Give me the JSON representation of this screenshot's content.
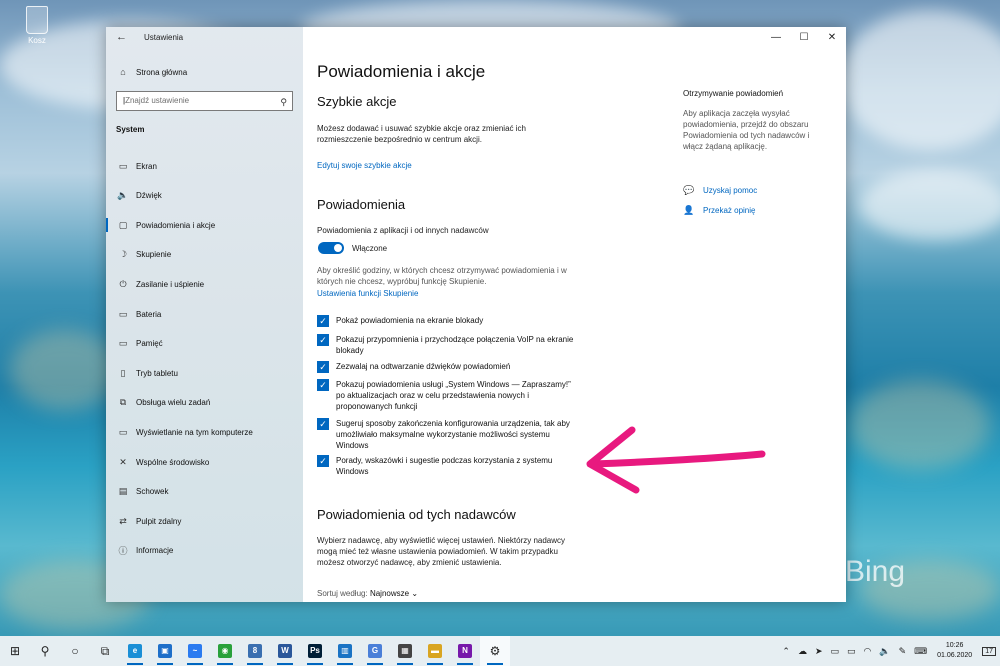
{
  "desktop": {
    "recycle_bin_label": "Kosz",
    "bing_watermark": "Bing"
  },
  "window": {
    "title": "Ustawienia",
    "controls": {
      "minimize": "—",
      "maximize": "☐",
      "close": "✕"
    }
  },
  "sidebar": {
    "home": "Strona główna",
    "search_placeholder": "Znajdź ustawienie",
    "section": "System",
    "items": [
      {
        "icon": "monitor-icon",
        "glyph": "▭",
        "label": "Ekran"
      },
      {
        "icon": "speaker-icon",
        "glyph": "🔈",
        "label": "Dźwięk"
      },
      {
        "icon": "notification-icon",
        "glyph": "▢",
        "label": "Powiadomienia i akcje",
        "active": true
      },
      {
        "icon": "moon-icon",
        "glyph": "☽",
        "label": "Skupienie"
      },
      {
        "icon": "power-icon",
        "glyph": "⏻",
        "label": "Zasilanie i uśpienie"
      },
      {
        "icon": "battery-icon",
        "glyph": "▭",
        "label": "Bateria"
      },
      {
        "icon": "storage-icon",
        "glyph": "▭",
        "label": "Pamięć"
      },
      {
        "icon": "tablet-icon",
        "glyph": "▯",
        "label": "Tryb tabletu"
      },
      {
        "icon": "multitasking-icon",
        "glyph": "⧉",
        "label": "Obsługa wielu zadań"
      },
      {
        "icon": "projecting-icon",
        "glyph": "▭",
        "label": "Wyświetlanie na tym komputerze"
      },
      {
        "icon": "shared-experiences-icon",
        "glyph": "✕",
        "label": "Wspólne środowisko"
      },
      {
        "icon": "clipboard-icon",
        "glyph": "▤",
        "label": "Schowek"
      },
      {
        "icon": "remote-desktop-icon",
        "glyph": "⇄",
        "label": "Pulpit zdalny"
      },
      {
        "icon": "info-icon",
        "glyph": "ⓘ",
        "label": "Informacje"
      }
    ]
  },
  "main": {
    "page_title": "Powiadomienia i akcje",
    "quick_actions": {
      "heading": "Szybkie akcje",
      "description_1": "Możesz dodawać i usuwać szybkie akcje oraz zmieniać ich",
      "description_2": "rozmieszczenie bezpośrednio w centrum akcji.",
      "edit_link": "Edytuj swoje szybkie akcje"
    },
    "notifications": {
      "heading": "Powiadomienia",
      "from_apps_label": "Powiadomienia z aplikacji i od innych nadawców",
      "toggle_state": "Włączone",
      "focus_text_1": "Aby określić godziny, w których chcesz otrzymywać powiadomienia i w",
      "focus_text_2": "których nie chcesz, wypróbuj funkcję Skupienie.",
      "focus_link": "Ustawienia funkcji Skupienie",
      "checkboxes": [
        {
          "lines": [
            "Pokaż powiadomienia na ekranie blokady"
          ],
          "checked": true
        },
        {
          "lines": [
            "Pokazuj przypomnienia i przychodzące połączenia VoIP na ekranie",
            "blokady"
          ],
          "checked": true
        },
        {
          "lines": [
            "Zezwalaj na odtwarzanie dźwięków powiadomień"
          ],
          "checked": true
        },
        {
          "lines": [
            "Pokazuj powiadomienia usługi „System Windows — Zapraszamy!”",
            "po aktualizacjach oraz w celu przedstawienia nowych i",
            "proponowanych funkcji"
          ],
          "checked": true
        },
        {
          "lines": [
            "Sugeruj sposoby zakończenia konfigurowania urządzenia, tak aby",
            "umożliwiało maksymalne wykorzystanie możliwości systemu",
            "Windows"
          ],
          "checked": true
        },
        {
          "lines": [
            "Porady, wskazówki i sugestie podczas korzystania z systemu",
            "Windows"
          ],
          "checked": true
        }
      ]
    },
    "senders": {
      "heading": "Powiadomienia od tych nadawców",
      "description_1": "Wybierz nadawcę, aby wyświetlić więcej ustawień. Niektórzy nadawcy",
      "description_2": "mogą mieć też własne ustawienia powiadomień. W takim przypadku",
      "description_3": "możesz otworzyć nadawcę, aby zmienić ustawienia.",
      "sort_label": "Sortuj według:",
      "sort_value": "Najnowsze"
    },
    "related": {
      "title": "Otrzymywanie powiadomień",
      "text_1": "Aby aplikacja zaczęła wysyłać",
      "text_2": "powiadomienia, przejdź do obszaru",
      "text_3": "Powiadomienia od tych nadawców i",
      "text_4": "włącz żądaną aplikację.",
      "help_link": "Uzyskaj pomoc",
      "feedback_link": "Przekaż opinię"
    }
  },
  "taskbar": {
    "apps": [
      {
        "name": "start-icon",
        "glyph": "⊞",
        "color": ""
      },
      {
        "name": "search-icon",
        "glyph": "⚲",
        "color": ""
      },
      {
        "name": "cortana-icon",
        "glyph": "○",
        "color": ""
      },
      {
        "name": "task-view-icon",
        "glyph": "⧉",
        "color": ""
      },
      {
        "name": "edge-icon",
        "glyph": "e",
        "color": "#1a8fd6"
      },
      {
        "name": "photos-icon",
        "glyph": "▣",
        "color": "#1e6fc9"
      },
      {
        "name": "messenger-icon",
        "glyph": "~",
        "color": "#2b7bf0"
      },
      {
        "name": "chrome-icon",
        "glyph": "◉",
        "color": "#2aa13b"
      },
      {
        "name": "phone-icon",
        "glyph": "8",
        "color": "#3a6fb0"
      },
      {
        "name": "word-icon",
        "glyph": "W",
        "color": "#2b579a"
      },
      {
        "name": "photoshop-icon",
        "glyph": "Ps",
        "color": "#001e36"
      },
      {
        "name": "planner-icon",
        "glyph": "▥",
        "color": "#1a73c4"
      },
      {
        "name": "translator-icon",
        "glyph": "G",
        "color": "#4a7fd8"
      },
      {
        "name": "calculator-icon",
        "glyph": "▦",
        "color": "#444444"
      },
      {
        "name": "explorer-icon",
        "glyph": "▬",
        "color": "#d9a521"
      },
      {
        "name": "onenote-icon",
        "glyph": "N",
        "color": "#7719aa"
      },
      {
        "name": "settings-icon",
        "glyph": "⚙",
        "color": ""
      }
    ],
    "clock_time": "10:26",
    "clock_date": "01.06.2020",
    "notification_count": "17"
  }
}
